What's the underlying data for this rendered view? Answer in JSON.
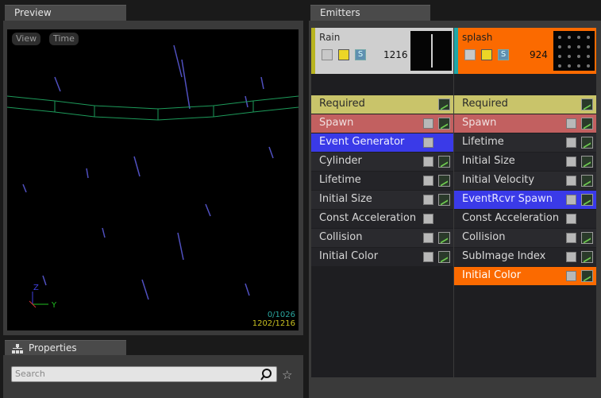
{
  "tabs": {
    "preview": "Preview",
    "emitters": "Emitters",
    "properties": "Properties"
  },
  "viewport": {
    "view_btn": "View",
    "time_btn": "Time",
    "stat_particles": "0/1026",
    "stat_total": "1202/1216",
    "axis_z": "Z",
    "axis_y": "Y"
  },
  "search": {
    "placeholder": "Search"
  },
  "emitters": [
    {
      "name": "Rain",
      "count": "1216",
      "modules": [
        "Required",
        "Spawn",
        "Event Generator",
        "Cylinder",
        "Lifetime",
        "Initial Size",
        "Const Acceleration",
        "Collision",
        "Initial Color"
      ]
    },
    {
      "name": "splash",
      "count": "924",
      "modules": [
        "Required",
        "Spawn",
        "Lifetime",
        "Initial Size",
        "Initial Velocity",
        "EventRcvr Spawn",
        "Const Acceleration",
        "Collision",
        "SubImage Index",
        "Initial Color"
      ]
    }
  ],
  "colors": {
    "rain_accent": "#b8b420",
    "splash_accent": "#fb6a00",
    "required": "#c9c46a",
    "spawn": "#c26060",
    "event": "#3a3ae8"
  }
}
